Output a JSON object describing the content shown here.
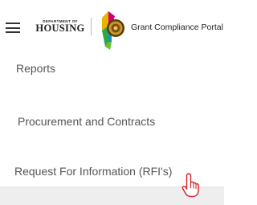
{
  "header": {
    "menu_icon": "hamburger-menu-icon",
    "dept_small": "DEPARTMENT OF",
    "dept_name": "HOUSING",
    "seal_icon": "state-seal-logo",
    "portal_title": "Grant Compliance Portal"
  },
  "menu": {
    "items": [
      {
        "label": "Reports"
      },
      {
        "label": "Procurement and Contracts"
      },
      {
        "label": "Request For Information (RFI's)"
      }
    ]
  },
  "cursor": {
    "icon": "pointer-hand-cursor-icon"
  }
}
